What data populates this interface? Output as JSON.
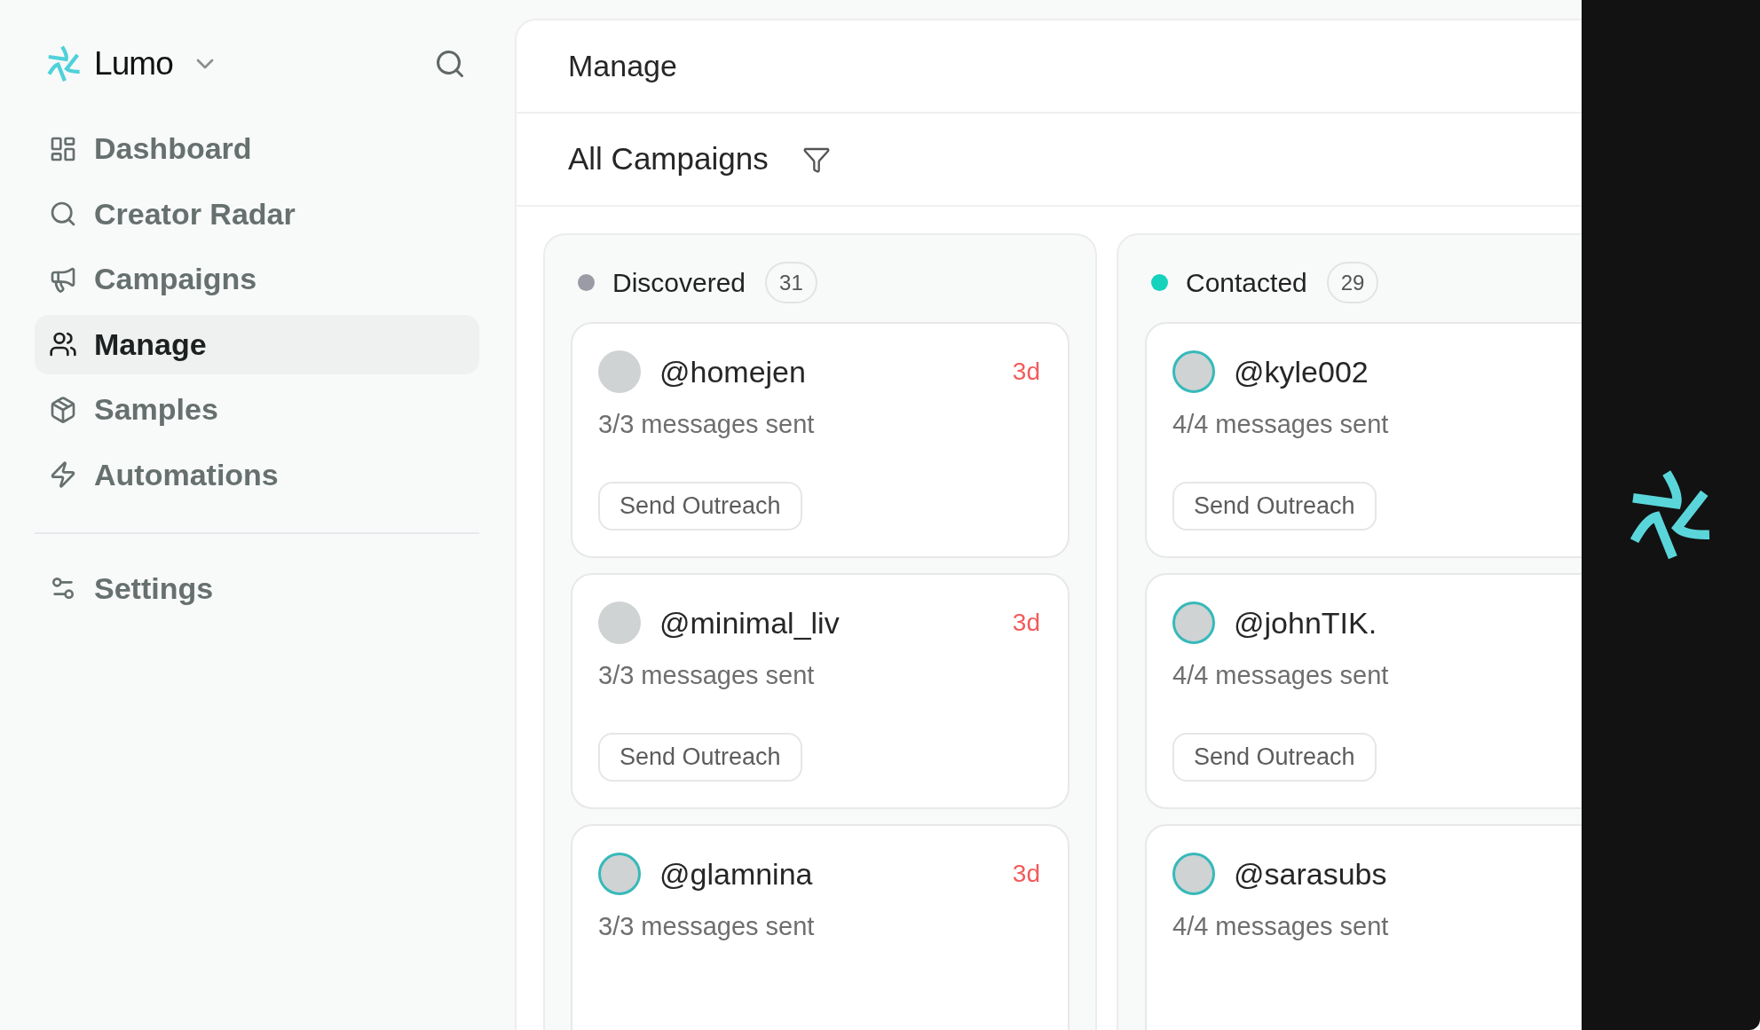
{
  "sidebar": {
    "brand": "Lumo",
    "nav": [
      {
        "label": "Dashboard",
        "selected": false
      },
      {
        "label": "Creator Radar",
        "selected": false
      },
      {
        "label": "Campaigns",
        "selected": false
      },
      {
        "label": "Manage",
        "selected": true
      },
      {
        "label": "Samples",
        "selected": false
      },
      {
        "label": "Automations",
        "selected": false
      }
    ],
    "footer_nav": [
      {
        "label": "Settings",
        "selected": false
      }
    ]
  },
  "header": {
    "title": "Manage"
  },
  "toolbar": {
    "campaign_filter": "All Campaigns"
  },
  "board": {
    "columns": [
      {
        "title": "Discovered",
        "count": "31",
        "color": "#9b9ba6",
        "cards": [
          {
            "handle": "@homejen",
            "age": "3d",
            "messages": "3/3 messages sent",
            "action": "Send Outreach",
            "ring": false
          },
          {
            "handle": "@minimal_liv",
            "age": "3d",
            "messages": "3/3 messages sent",
            "action": "Send Outreach",
            "ring": false
          },
          {
            "handle": "@glamnina",
            "age": "3d",
            "messages": "3/3 messages sent",
            "ring": true
          }
        ]
      },
      {
        "title": "Contacted",
        "count": "29",
        "color": "#14d2bc",
        "cards": [
          {
            "handle": "@kyle002",
            "messages": "4/4 messages sent",
            "action": "Send Outreach",
            "ring": true
          },
          {
            "handle": "@johnTIK.",
            "messages": "4/4 messages sent",
            "action": "Send Outreach",
            "ring": true
          },
          {
            "handle": "@sarasubs",
            "messages": "4/4 messages sent",
            "ring": true
          }
        ]
      }
    ]
  }
}
